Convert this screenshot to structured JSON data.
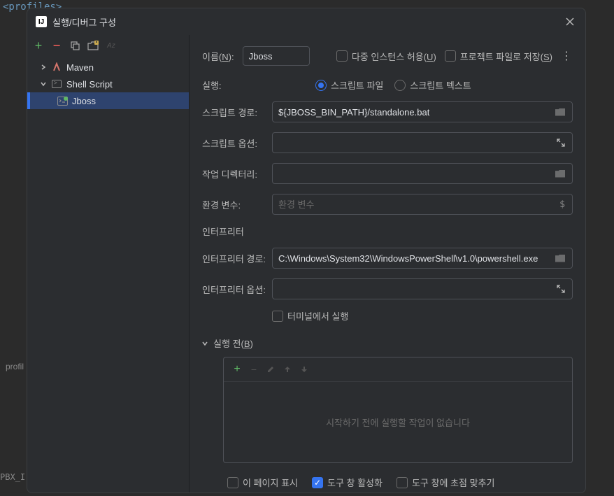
{
  "bg": {
    "code_fragment": "<profiles>",
    "bottom_left_1": "profil",
    "bottom_left_2": "PBX_I"
  },
  "dialog": {
    "title": "실행/디버그 구성"
  },
  "tree": {
    "maven_label": "Maven",
    "shell_label": "Shell Script",
    "jboss_label": "Jboss"
  },
  "form": {
    "name_label_prefix": "이름(",
    "name_label_key": "N",
    "name_label_suffix": "):",
    "name_value": "Jboss",
    "allow_multi_prefix": "다중 인스턴스 허용(",
    "allow_multi_key": "U",
    "allow_multi_suffix": ")",
    "save_project_prefix": "프로젝트 파일로 저장(",
    "save_project_key": "S",
    "save_project_suffix": ")",
    "execute_label": "실행:",
    "radio_script_file": "스크립트 파일",
    "radio_script_text": "스크립트 텍스트",
    "script_path_label": "스크립트 경로:",
    "script_path_value": "${JBOSS_BIN_PATH}/standalone.bat",
    "script_options_label": "스크립트 옵션:",
    "working_dir_label": "작업 디렉터리:",
    "env_vars_label": "환경 변수:",
    "env_vars_placeholder": "환경 변수",
    "interpreter_section": "인터프리터",
    "interpreter_path_label": "인터프리터 경로:",
    "interpreter_path_value": "C:\\Windows\\System32\\WindowsPowerShell\\v1.0\\powershell.exe",
    "interpreter_options_label": "인터프리터 옵션:",
    "run_in_terminal": "터미널에서 실행",
    "before_section_prefix": "실행 전(",
    "before_section_key": "B",
    "before_section_suffix": ")",
    "before_empty_text": "시작하기 전에 실행할 작업이 없습니다",
    "footer_show_page": "이 페이지 표시",
    "footer_activate_tool": "도구 창 활성화",
    "footer_focus_tool": "도구 창에 초점 맞추기"
  }
}
